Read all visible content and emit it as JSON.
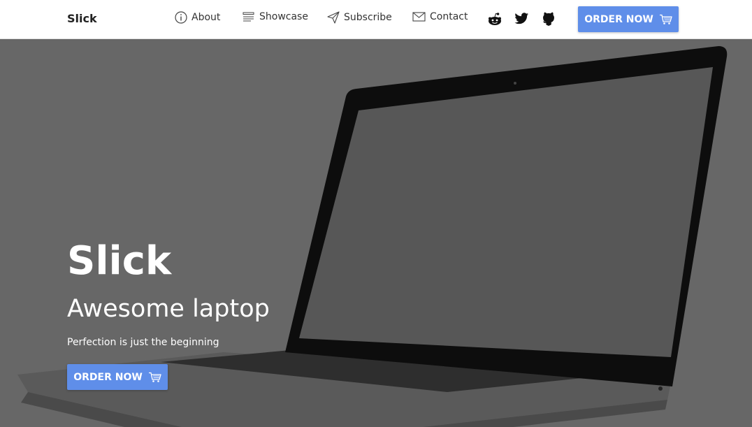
{
  "nav": {
    "brand": "Slick",
    "items": [
      {
        "label": "About",
        "icon": "info-icon"
      },
      {
        "label": "Showcase",
        "icon": "list-icon"
      },
      {
        "label": "Subscribe",
        "icon": "paper-plane-icon"
      },
      {
        "label": "Contact",
        "icon": "envelope-icon"
      }
    ],
    "social": [
      "reddit-icon",
      "twitter-icon",
      "github-icon"
    ],
    "order_label": "ORDER NOW"
  },
  "hero": {
    "title": "Slick",
    "subtitle": "Awesome laptop",
    "description": "Perfection is just the beginning",
    "order_label": "ORDER NOW"
  },
  "colors": {
    "accent": "#5f8ee9",
    "hero_overlay": "#676767"
  }
}
